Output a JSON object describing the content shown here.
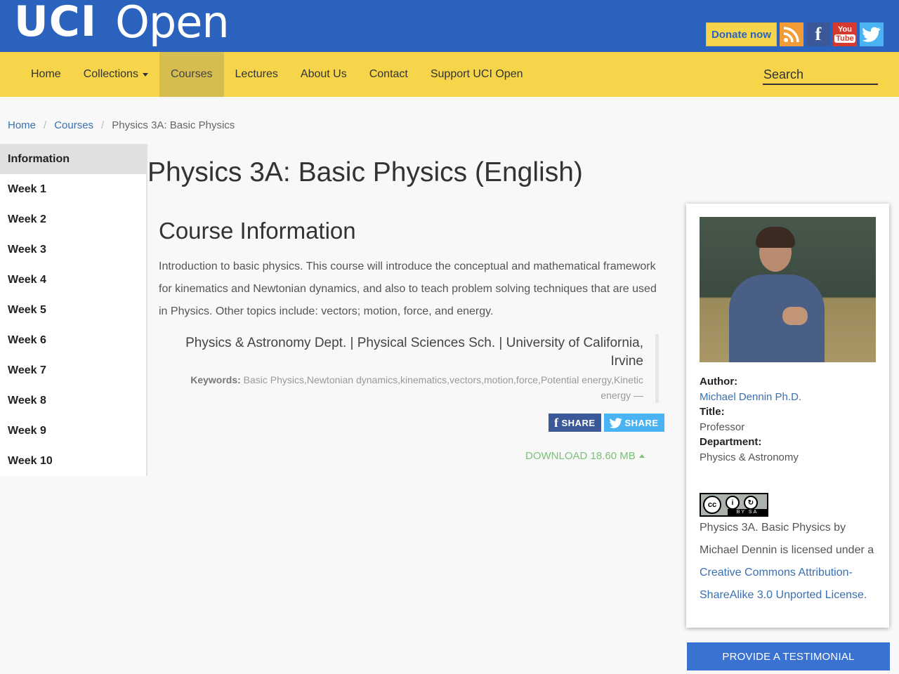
{
  "header": {
    "logo_uci": "UCI",
    "logo_open": "Open",
    "donate_label": "Donate now",
    "youtube_top": "You",
    "youtube_bottom": "Tube",
    "facebook_glyph": "f",
    "brand_colors": {
      "topbar": "#2b62bd",
      "navbar": "#f6d54b",
      "rss": "#f29c38",
      "facebook": "#3b5998",
      "youtube": "#d6392d",
      "twitter": "#4ab3f4"
    }
  },
  "nav": {
    "items": [
      {
        "label": "Home"
      },
      {
        "label": "Collections"
      },
      {
        "label": "Courses"
      },
      {
        "label": "Lectures"
      },
      {
        "label": "About Us"
      },
      {
        "label": "Contact"
      },
      {
        "label": "Support UCI Open"
      }
    ],
    "active": "Courses",
    "search_placeholder": "Search"
  },
  "breadcrumb": {
    "items": [
      "Home",
      "Courses"
    ],
    "separator": "/",
    "current": "Physics 3A: Basic Physics"
  },
  "sidebar": {
    "items": [
      {
        "label": "Information"
      },
      {
        "label": "Week 1"
      },
      {
        "label": "Week 2"
      },
      {
        "label": "Week 3"
      },
      {
        "label": "Week 4"
      },
      {
        "label": "Week 5"
      },
      {
        "label": "Week 6"
      },
      {
        "label": "Week 7"
      },
      {
        "label": "Week 8"
      },
      {
        "label": "Week 9"
      },
      {
        "label": "Week 10"
      }
    ],
    "active": "Information"
  },
  "main": {
    "title": "Physics 3A: Basic Physics (English)",
    "section_title": "Course Information",
    "description": "Introduction to basic physics. This course will introduce the conceptual and mathematical framework for kinematics and Newtonian dynamics, and also to teach problem solving techniques that are used in Physics. Other topics include: vectors; motion, force, and energy.",
    "department_line": "Physics & Astronomy Dept. | Physical Sciences Sch. | University of California, Irvine",
    "keywords_label": "Keywords:",
    "keywords": "Basic Physics,Newtonian dynamics,kinematics,vectors,motion,force,Potential energy,Kinetic energy —",
    "share_facebook_label": "SHARE",
    "share_twitter_label": "SHARE",
    "download_label": "DOWNLOAD 18.60 MB"
  },
  "author_card": {
    "author_label": "Author:",
    "author_name": "Michael Dennin Ph.D.",
    "title_label": "Title:",
    "title_value": "Professor",
    "department_label": "Department:",
    "department_value": "Physics & Astronomy",
    "cc_badge": {
      "cc": "cc",
      "by": "BY",
      "sa": "SA"
    },
    "license_text_prefix": "Physics 3A. Basic Physics by Michael Dennin is licensed under a ",
    "license_link": "Creative Commons Attribution-ShareAlike 3.0 Unported License."
  },
  "testimonial_label": "PROVIDE A TESTIMONIAL"
}
